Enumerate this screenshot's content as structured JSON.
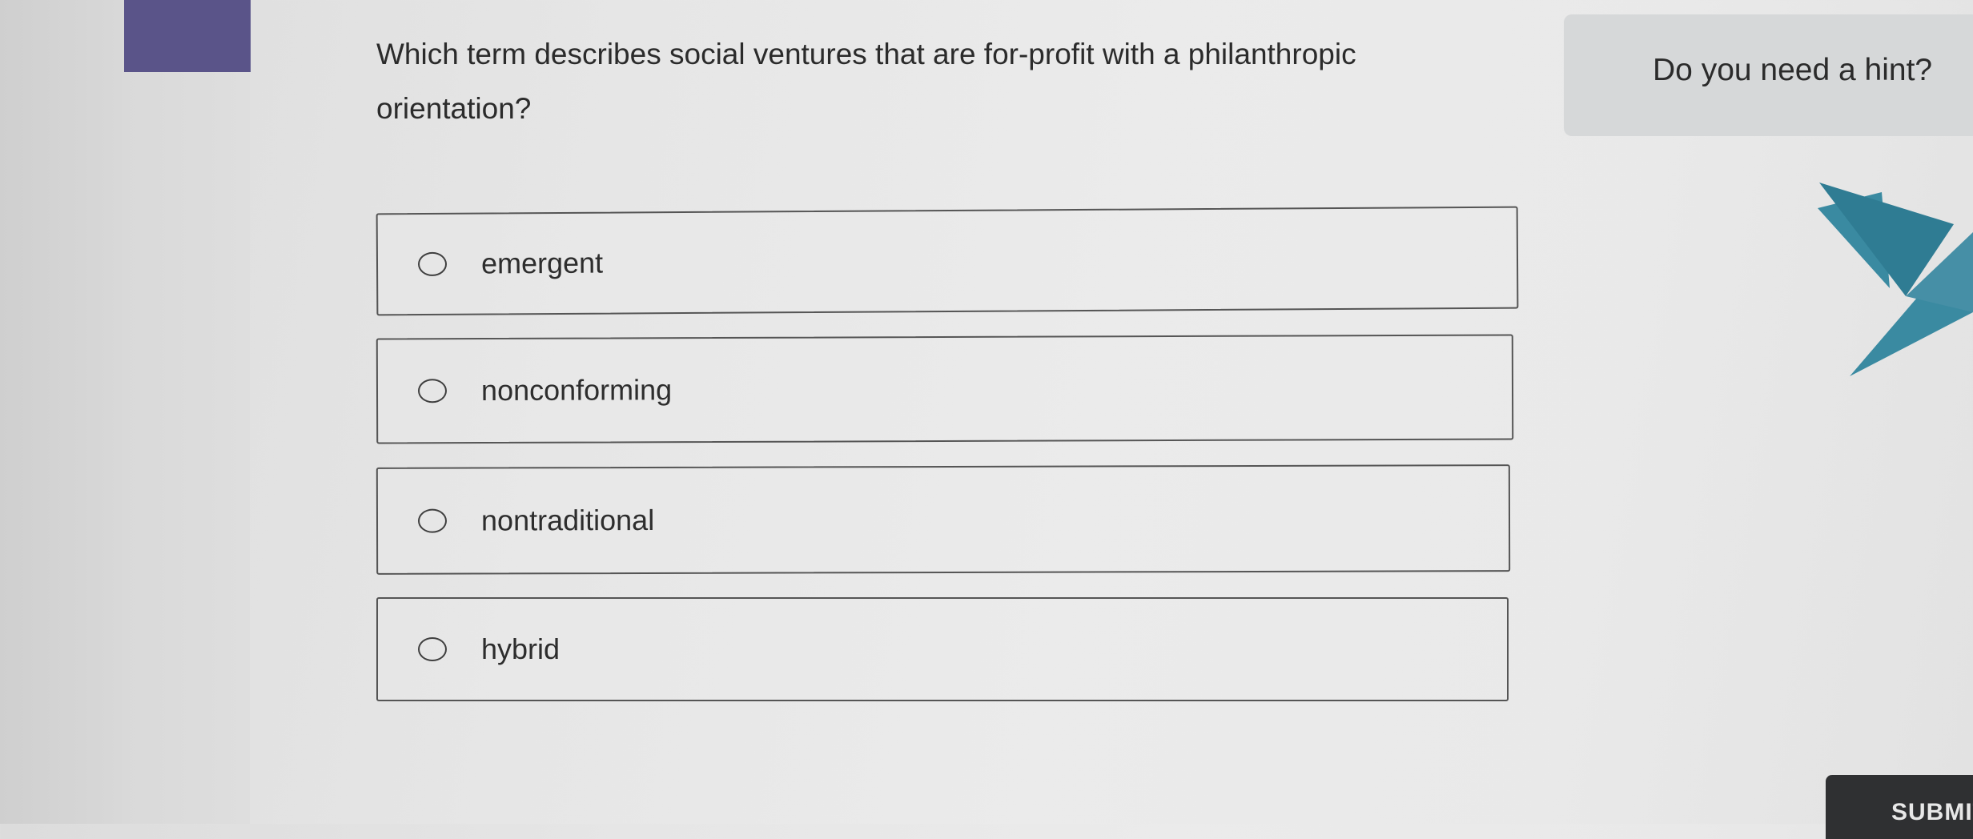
{
  "question": {
    "text": "Which term describes social ventures that are for-profit with a philanthropic orientation?"
  },
  "options": [
    {
      "label": "emergent"
    },
    {
      "label": "nonconforming"
    },
    {
      "label": "nontraditional"
    },
    {
      "label": "hybrid"
    }
  ],
  "hint": {
    "label": "Do you need a hint?"
  },
  "submit": {
    "label": "SUBMIT"
  },
  "colors": {
    "sidebar_tab": "#5a5489",
    "crane_primary": "#3a8aa1",
    "crane_dark": "#2f7c93",
    "hint_background": "#d6d8d9",
    "submit_background": "#2f3032"
  },
  "icons": {
    "mascot": "origami-crane-icon",
    "option_marker": "radio-circle-icon"
  }
}
